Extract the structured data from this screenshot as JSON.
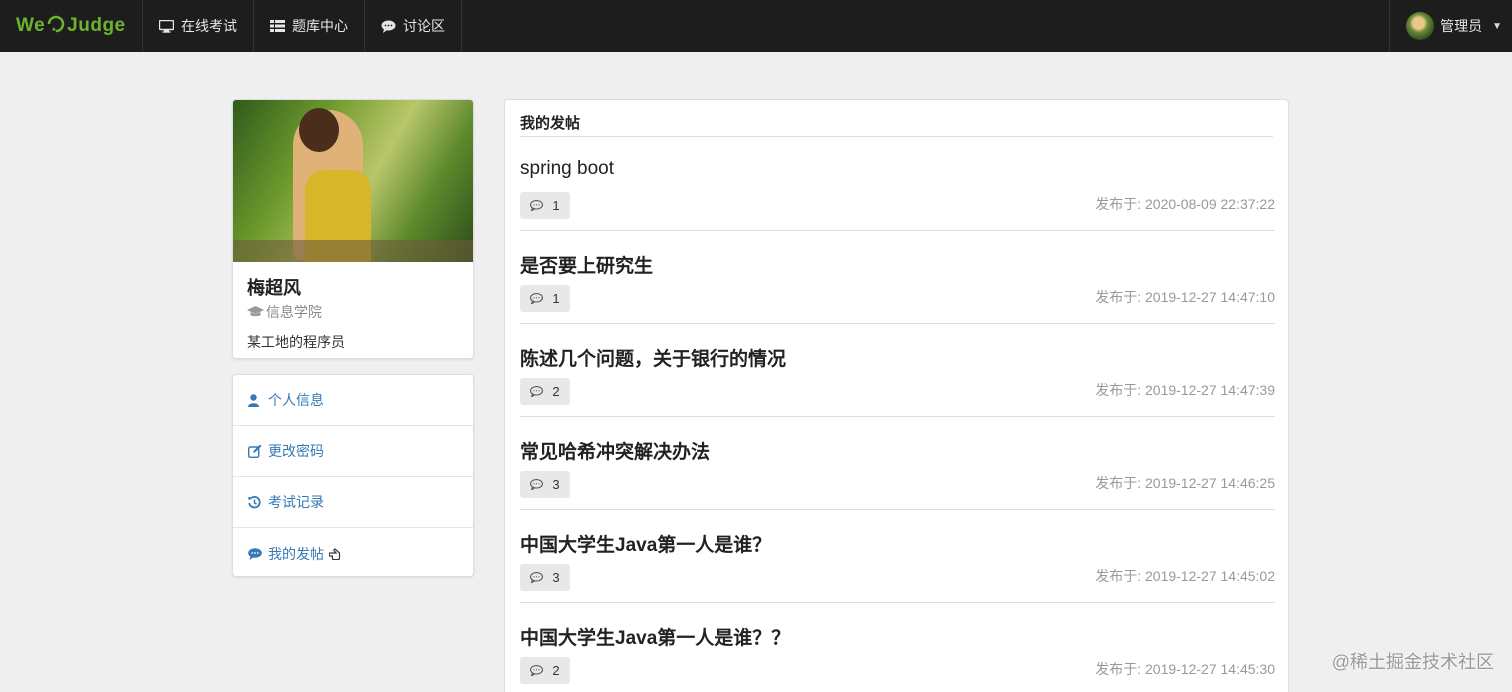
{
  "navbar": {
    "brand_left": "We",
    "brand_right": "Judge",
    "items": [
      {
        "label": "在线考试",
        "icon": "monitor-icon"
      },
      {
        "label": "题库中心",
        "icon": "list-icon"
      },
      {
        "label": "讨论区",
        "icon": "comment-icon"
      }
    ],
    "user": {
      "name": "管理员"
    }
  },
  "profile": {
    "name": "梅超风",
    "college": "信息学院",
    "bio": "某工地的程序员"
  },
  "menu": [
    {
      "label": "个人信息",
      "icon": "user-icon"
    },
    {
      "label": "更改密码",
      "icon": "edit-icon"
    },
    {
      "label": "考试记录",
      "icon": "history-icon"
    },
    {
      "label": "我的发帖",
      "icon": "comment-icon"
    }
  ],
  "posts": {
    "title": "我的发帖",
    "time_prefix": "发布于: ",
    "items": [
      {
        "title": "spring boot",
        "replies": "1",
        "time": "发布于: 2020-08-09 22:37:22"
      },
      {
        "title": "是否要上研究生",
        "replies": "1",
        "time": "发布于: 2019-12-27 14:47:10"
      },
      {
        "title": "陈述几个问题，关于银行的情况",
        "replies": "2",
        "time": "发布于: 2019-12-27 14:47:39"
      },
      {
        "title": "常见哈希冲突解决办法",
        "replies": "3",
        "time": "发布于: 2019-12-27 14:46:25"
      },
      {
        "title": "中国大学生Java第一人是谁？",
        "replies": "3",
        "time": "发布于: 2019-12-27 14:45:02"
      },
      {
        "title": "中国大学生Java第一人是谁？？",
        "replies": "2",
        "time": "发布于: 2019-12-27 14:45:30"
      }
    ]
  },
  "watermark": "@稀土掘金技术社区",
  "colors": {
    "brand": "#6ab42e",
    "link": "#337ab7",
    "navbar": "#1d1d1d"
  }
}
